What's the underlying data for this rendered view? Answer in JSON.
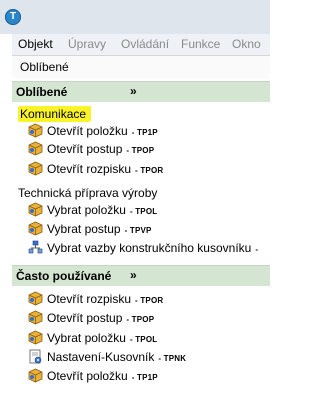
{
  "titlebar": {
    "icon_glyph": "T",
    "icon": "app-logo-icon",
    "color": "#2a86c8"
  },
  "menu": {
    "items": [
      {
        "label": "Objekt",
        "active": true
      },
      {
        "label": "Úpravy",
        "active": false
      },
      {
        "label": "Ovládání",
        "active": false
      },
      {
        "label": "Funkce",
        "active": false
      },
      {
        "label": "Okno",
        "active": false
      }
    ]
  },
  "toolbar": {
    "label": "Oblíbené"
  },
  "favorites": {
    "title": "Oblíbené",
    "chevron": "»",
    "groups": [
      {
        "label": "Komunikace",
        "items": [
          {
            "label": "Otevřít položku",
            "code": "- TP1P",
            "icon": "package-icon"
          },
          {
            "label": "Otevřít postup",
            "code": "- TPOP",
            "icon": "package-icon"
          },
          {
            "label": "Otevřít rozpisku",
            "code": "- TPOR",
            "icon": "package-icon"
          }
        ]
      },
      {
        "label": "Technická příprava výroby",
        "items": [
          {
            "label": "Vybrat položku",
            "code": "- TPOL",
            "icon": "package-icon"
          },
          {
            "label": "Vybrat postup",
            "code": "- TPVP",
            "icon": "package-icon"
          },
          {
            "label": "Vybrat vazby konstrukčního kusovníku",
            "code": "-",
            "icon": "tree-icon"
          }
        ]
      }
    ]
  },
  "frequent": {
    "title": "Často používané",
    "chevron": "»",
    "items": [
      {
        "label": "Otevřít rozpisku",
        "code": "- TPOR",
        "icon": "package-icon"
      },
      {
        "label": "Otevřít postup",
        "code": "- TPOP",
        "icon": "package-icon"
      },
      {
        "label": "Vybrat položku",
        "code": "- TPOL",
        "icon": "package-icon"
      },
      {
        "label": "Nastavení-Kusovník",
        "code": "- TPNK",
        "icon": "settings-doc-icon"
      },
      {
        "label": "Otevřít položku",
        "code": "- TP1P",
        "icon": "package-icon"
      }
    ]
  },
  "colors": {
    "section_bg": "#d4e6d1",
    "highlight": "#fbf32a",
    "titlebar": "#dfe5ec"
  }
}
